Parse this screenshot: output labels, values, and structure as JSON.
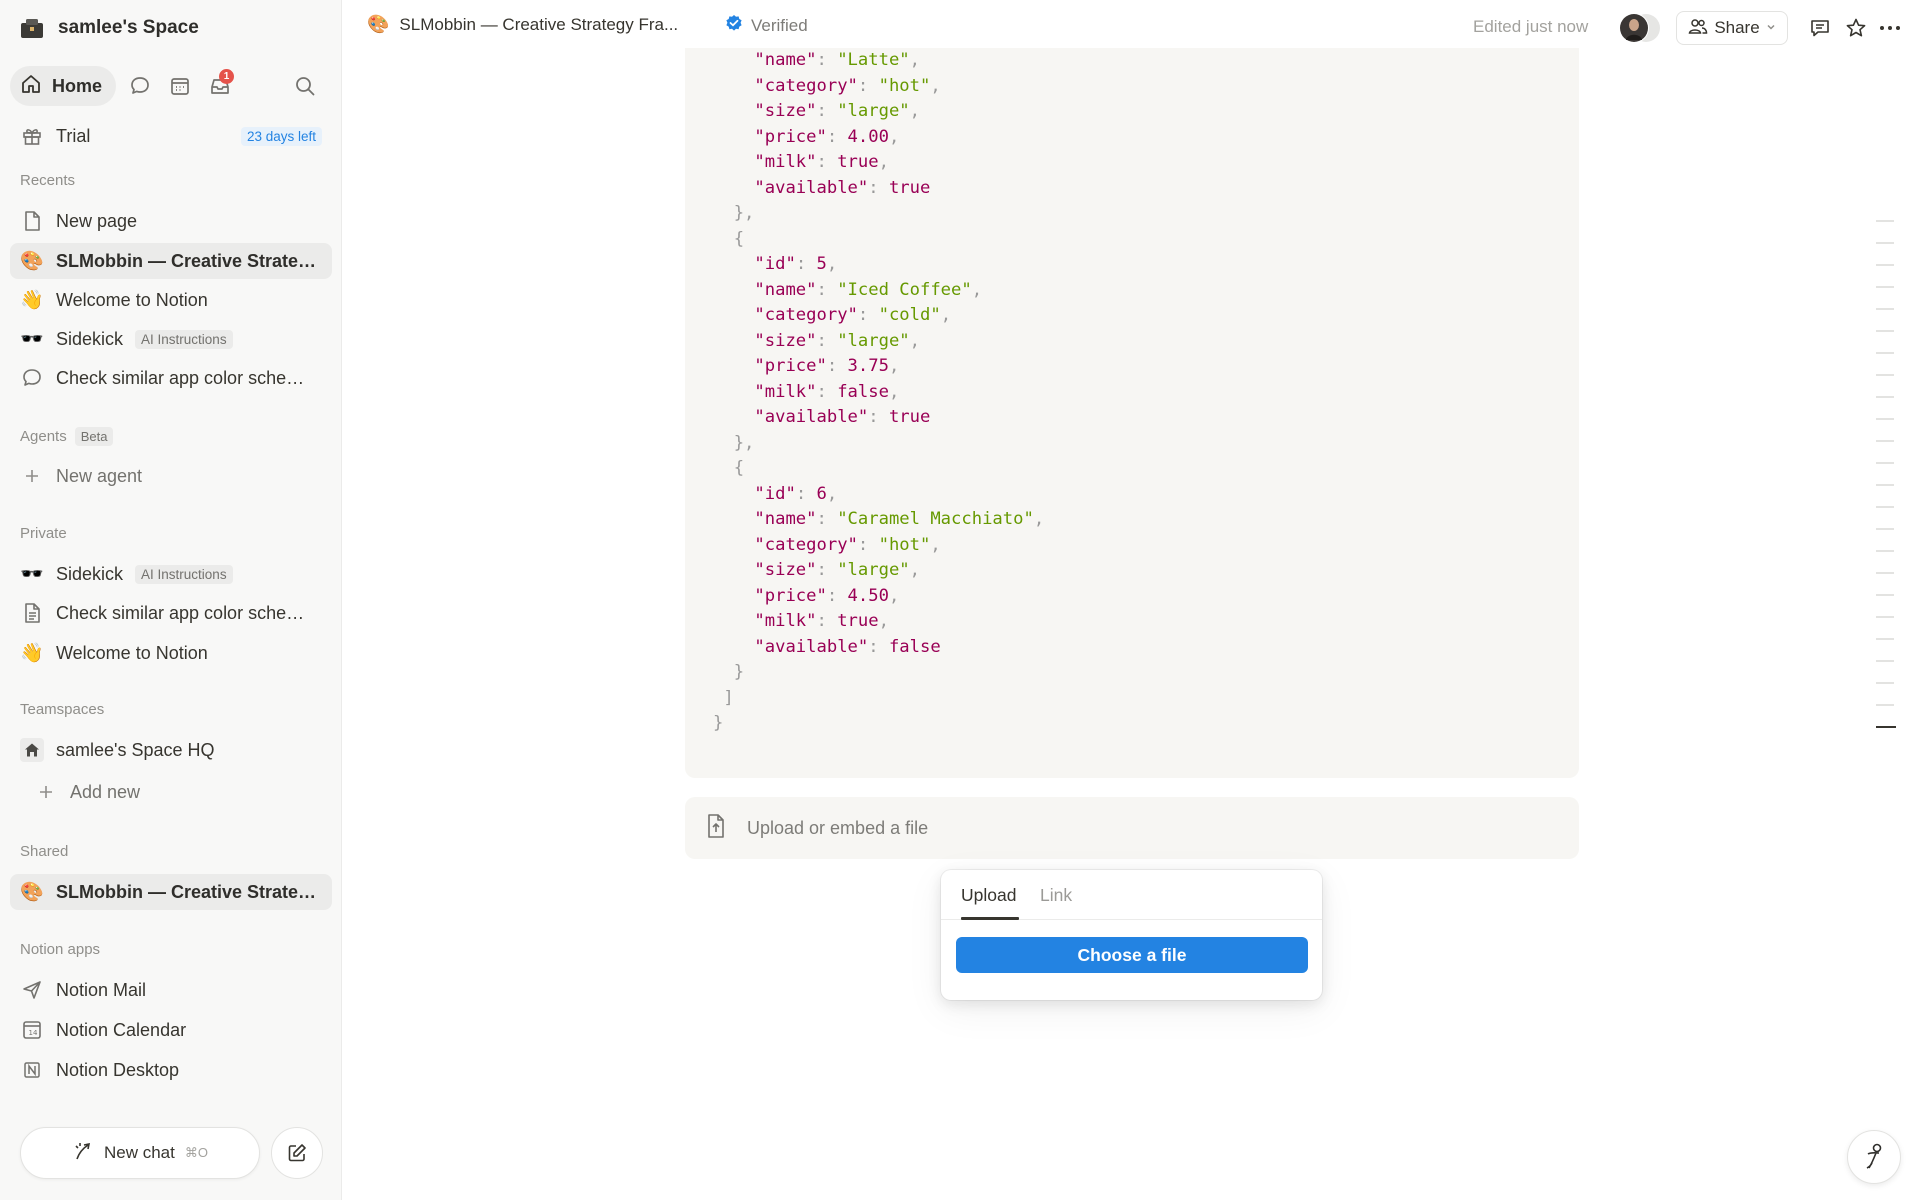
{
  "sidebar": {
    "workspace_name": "samlee's Space",
    "home_label": "Home",
    "inbox_badge": "1",
    "trial": {
      "label": "Trial",
      "days_left": "23 days left"
    },
    "recents_label": "Recents",
    "recents": [
      {
        "label": "New page",
        "icon": "page-icon"
      },
      {
        "label": "SLMobbin — Creative Strategy Framework",
        "icon": "palette-emoji"
      },
      {
        "label": "Welcome to Notion",
        "icon": "wave-emoji"
      },
      {
        "label": "Sidekick",
        "icon": "sunglasses-emoji",
        "tag": "AI Instructions"
      },
      {
        "label": "Check similar app color schemes",
        "icon": "chat-bubble-icon"
      }
    ],
    "agents_label": "Agents",
    "agents_tag": "Beta",
    "new_agent_label": "New agent",
    "private_label": "Private",
    "private": [
      {
        "label": "Sidekick",
        "icon": "sunglasses-emoji",
        "tag": "AI Instructions"
      },
      {
        "label": "Check similar app color schemes",
        "icon": "page-icon"
      },
      {
        "label": "Welcome to Notion",
        "icon": "wave-emoji"
      }
    ],
    "teamspaces_label": "Teamspaces",
    "teamspace": "samlee's Space HQ",
    "add_new_label": "Add new",
    "shared_label": "Shared",
    "shared": [
      {
        "label": "SLMobbin — Creative Strategy Framework",
        "icon": "palette-emoji"
      }
    ],
    "apps_label": "Notion apps",
    "apps": [
      {
        "label": "Notion Mail",
        "icon": "send-icon"
      },
      {
        "label": "Notion Calendar",
        "icon": "calendar-icon"
      },
      {
        "label": "Notion Desktop",
        "icon": "notion-logo-icon"
      }
    ],
    "new_chat_label": "New chat",
    "new_chat_shortcut": "⌘O"
  },
  "topbar": {
    "page_title": "SLMobbin — Creative Strategy Fra...",
    "verified_label": "Verified",
    "edited_label": "Edited just now",
    "share_label": "Share"
  },
  "code_lines": [
    [
      [
        "p",
        "    "
      ],
      [
        "k",
        "\"name\""
      ],
      [
        "p",
        ": "
      ],
      [
        "s",
        "\"Latte\""
      ],
      [
        "p",
        ","
      ]
    ],
    [
      [
        "p",
        "    "
      ],
      [
        "k",
        "\"category\""
      ],
      [
        "p",
        ": "
      ],
      [
        "s",
        "\"hot\""
      ],
      [
        "p",
        ","
      ]
    ],
    [
      [
        "p",
        "    "
      ],
      [
        "k",
        "\"size\""
      ],
      [
        "p",
        ": "
      ],
      [
        "s",
        "\"large\""
      ],
      [
        "p",
        ","
      ]
    ],
    [
      [
        "p",
        "    "
      ],
      [
        "k",
        "\"price\""
      ],
      [
        "p",
        ": "
      ],
      [
        "n",
        "4.00"
      ],
      [
        "p",
        ","
      ]
    ],
    [
      [
        "p",
        "    "
      ],
      [
        "k",
        "\"milk\""
      ],
      [
        "p",
        ": "
      ],
      [
        "n",
        "true"
      ],
      [
        "p",
        ","
      ]
    ],
    [
      [
        "p",
        "    "
      ],
      [
        "k",
        "\"available\""
      ],
      [
        "p",
        ": "
      ],
      [
        "n",
        "true"
      ]
    ],
    [
      [
        "p",
        "  },"
      ]
    ],
    [
      [
        "p",
        "  {"
      ]
    ],
    [
      [
        "p",
        "    "
      ],
      [
        "k",
        "\"id\""
      ],
      [
        "p",
        ": "
      ],
      [
        "n",
        "5"
      ],
      [
        "p",
        ","
      ]
    ],
    [
      [
        "p",
        "    "
      ],
      [
        "k",
        "\"name\""
      ],
      [
        "p",
        ": "
      ],
      [
        "s",
        "\"Iced Coffee\""
      ],
      [
        "p",
        ","
      ]
    ],
    [
      [
        "p",
        "    "
      ],
      [
        "k",
        "\"category\""
      ],
      [
        "p",
        ": "
      ],
      [
        "s",
        "\"cold\""
      ],
      [
        "p",
        ","
      ]
    ],
    [
      [
        "p",
        "    "
      ],
      [
        "k",
        "\"size\""
      ],
      [
        "p",
        ": "
      ],
      [
        "s",
        "\"large\""
      ],
      [
        "p",
        ","
      ]
    ],
    [
      [
        "p",
        "    "
      ],
      [
        "k",
        "\"price\""
      ],
      [
        "p",
        ": "
      ],
      [
        "n",
        "3.75"
      ],
      [
        "p",
        ","
      ]
    ],
    [
      [
        "p",
        "    "
      ],
      [
        "k",
        "\"milk\""
      ],
      [
        "p",
        ": "
      ],
      [
        "n",
        "false"
      ],
      [
        "p",
        ","
      ]
    ],
    [
      [
        "p",
        "    "
      ],
      [
        "k",
        "\"available\""
      ],
      [
        "p",
        ": "
      ],
      [
        "n",
        "true"
      ]
    ],
    [
      [
        "p",
        "  },"
      ]
    ],
    [
      [
        "p",
        "  {"
      ]
    ],
    [
      [
        "p",
        "    "
      ],
      [
        "k",
        "\"id\""
      ],
      [
        "p",
        ": "
      ],
      [
        "n",
        "6"
      ],
      [
        "p",
        ","
      ]
    ],
    [
      [
        "p",
        "    "
      ],
      [
        "k",
        "\"name\""
      ],
      [
        "p",
        ": "
      ],
      [
        "s",
        "\"Caramel Macchiato\""
      ],
      [
        "p",
        ","
      ]
    ],
    [
      [
        "p",
        "    "
      ],
      [
        "k",
        "\"category\""
      ],
      [
        "p",
        ": "
      ],
      [
        "s",
        "\"hot\""
      ],
      [
        "p",
        ","
      ]
    ],
    [
      [
        "p",
        "    "
      ],
      [
        "k",
        "\"size\""
      ],
      [
        "p",
        ": "
      ],
      [
        "s",
        "\"large\""
      ],
      [
        "p",
        ","
      ]
    ],
    [
      [
        "p",
        "    "
      ],
      [
        "k",
        "\"price\""
      ],
      [
        "p",
        ": "
      ],
      [
        "n",
        "4.50"
      ],
      [
        "p",
        ","
      ]
    ],
    [
      [
        "p",
        "    "
      ],
      [
        "k",
        "\"milk\""
      ],
      [
        "p",
        ": "
      ],
      [
        "n",
        "true"
      ],
      [
        "p",
        ","
      ]
    ],
    [
      [
        "p",
        "    "
      ],
      [
        "k",
        "\"available\""
      ],
      [
        "p",
        ": "
      ],
      [
        "n",
        "false"
      ]
    ],
    [
      [
        "p",
        "  }"
      ]
    ],
    [
      [
        "p",
        " ]"
      ]
    ],
    [
      [
        "p",
        "}"
      ]
    ]
  ],
  "embed": {
    "placeholder": "Upload or embed a file",
    "tab_upload": "Upload",
    "tab_link": "Link",
    "choose_label": "Choose a file"
  },
  "colors": {
    "accent": "#2383e2",
    "sidebar_bg": "#f8f8f7",
    "code_bg": "#f7f6f3",
    "code_key": "#990055",
    "code_string": "#669900"
  }
}
